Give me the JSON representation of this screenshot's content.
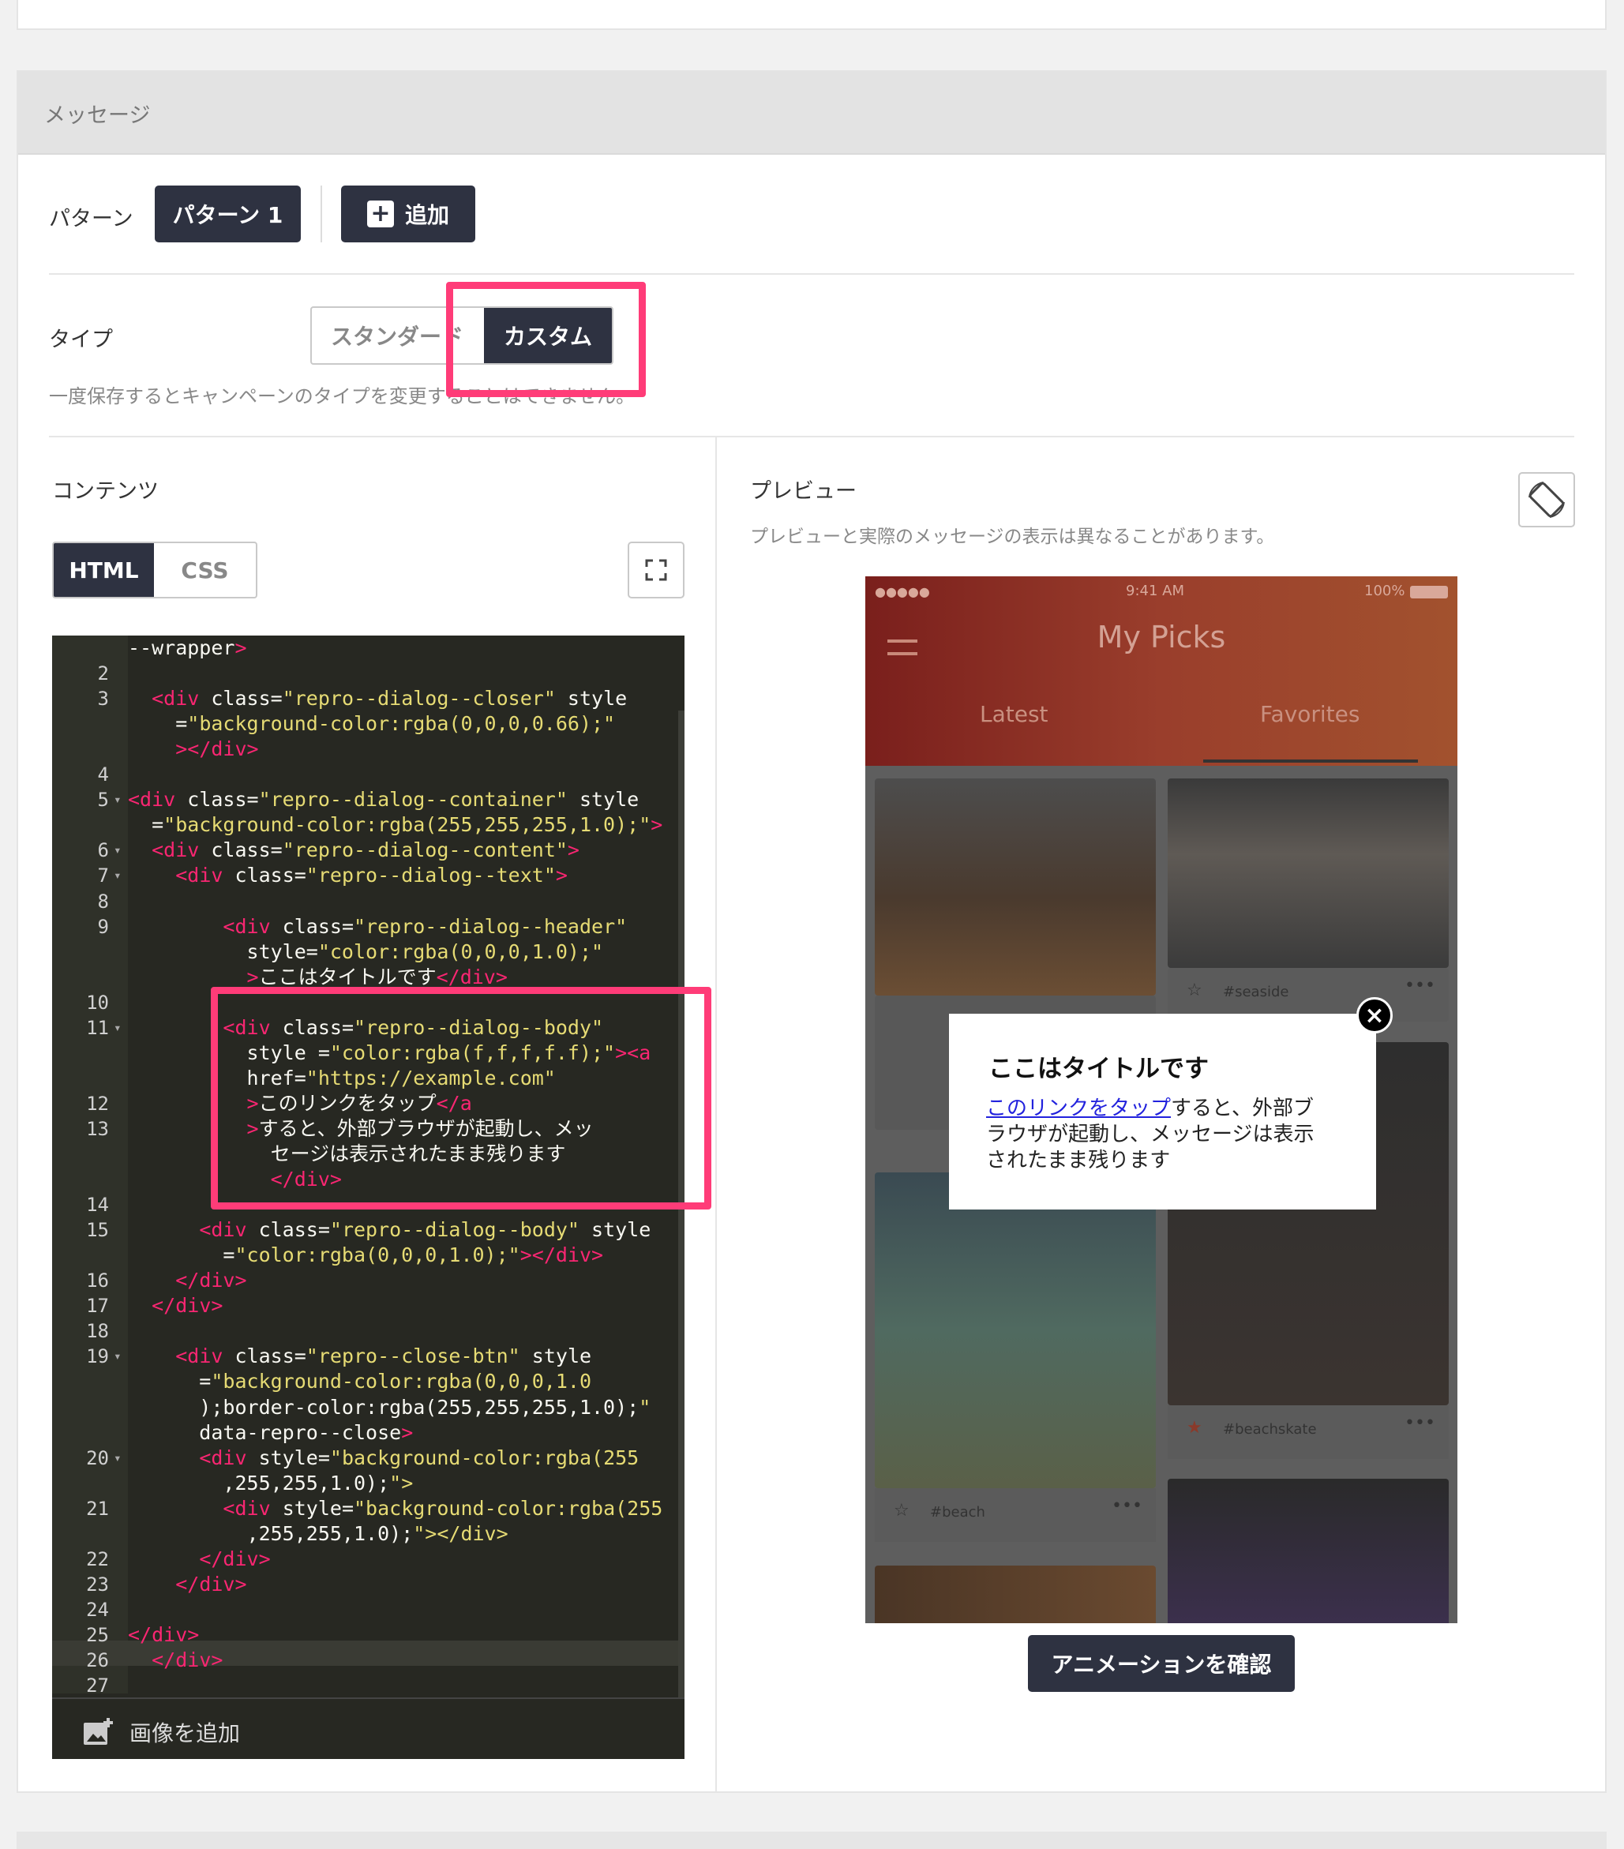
{
  "section": {
    "title": "メッセージ"
  },
  "pattern": {
    "label": "パターン",
    "active": "パターン 1",
    "add_label": "追加"
  },
  "type": {
    "label": "タイプ",
    "options": [
      "スタンダード",
      "カスタム"
    ],
    "selected": "カスタム",
    "note": "一度保存するとキャンペーンのタイプを変更することはできません。"
  },
  "content": {
    "label": "コンテンツ",
    "tabs": [
      "HTML",
      "CSS"
    ],
    "active_tab": "HTML",
    "add_image_label": "画像を追加"
  },
  "code_lines": [
    {
      "ln": "",
      "fold": false,
      "text": "    --wrapper>"
    },
    {
      "ln": "2",
      "fold": false,
      "text": ""
    },
    {
      "ln": "3",
      "fold": false,
      "text": "      <div class=\"repro--dialog--closer\" style"
    },
    {
      "ln": "",
      "fold": false,
      "text": "        =\"background-color:rgba(0,0,0,0.66);\""
    },
    {
      "ln": "",
      "fold": false,
      "text": "        ></div>"
    },
    {
      "ln": "4",
      "fold": false,
      "text": ""
    },
    {
      "ln": "5",
      "fold": true,
      "text": "    <div class=\"repro--dialog--container\" style"
    },
    {
      "ln": "",
      "fold": false,
      "text": "      =\"background-color:rgba(255,255,255,1.0);\">"
    },
    {
      "ln": "6",
      "fold": true,
      "text": "      <div class=\"repro--dialog--content\">"
    },
    {
      "ln": "7",
      "fold": true,
      "text": "        <div class=\"repro--dialog--text\">"
    },
    {
      "ln": "8",
      "fold": false,
      "text": ""
    },
    {
      "ln": "9",
      "fold": false,
      "text": "            <div class=\"repro--dialog--header\""
    },
    {
      "ln": "",
      "fold": false,
      "text": "              style=\"color:rgba(0,0,0,1.0);\""
    },
    {
      "ln": "",
      "fold": false,
      "text": "              >ここはタイトルです</div>"
    },
    {
      "ln": "10",
      "fold": false,
      "text": ""
    },
    {
      "ln": "11",
      "fold": true,
      "text": "            <div class=\"repro--dialog--body\""
    },
    {
      "ln": "",
      "fold": false,
      "text": "              style =\"color:rgba(f,f,f,f.f);\"><a"
    },
    {
      "ln": "",
      "fold": false,
      "text": "              href=\"https://example.com\""
    },
    {
      "ln": "12",
      "fold": false,
      "text": "              >このリンクをタップ</a"
    },
    {
      "ln": "13",
      "fold": false,
      "text": "              >すると、外部ブラウザが起動し、メッ"
    },
    {
      "ln": "",
      "fold": false,
      "text": "                セージは表示されたまま残ります"
    },
    {
      "ln": "",
      "fold": false,
      "text": "                </div>"
    },
    {
      "ln": "14",
      "fold": false,
      "text": ""
    },
    {
      "ln": "15",
      "fold": false,
      "text": "          <div class=\"repro--dialog--body\" style"
    },
    {
      "ln": "",
      "fold": false,
      "text": "            =\"color:rgba(0,0,0,1.0);\"></div>"
    },
    {
      "ln": "16",
      "fold": false,
      "text": "        </div>"
    },
    {
      "ln": "17",
      "fold": false,
      "text": "      </div>"
    },
    {
      "ln": "18",
      "fold": false,
      "text": ""
    },
    {
      "ln": "19",
      "fold": true,
      "text": "        <div class=\"repro--close-btn\" style"
    },
    {
      "ln": "",
      "fold": false,
      "text": "          =\"background-color:rgba(0,0,0,1.0"
    },
    {
      "ln": "",
      "fold": false,
      "text": "          );border-color:rgba(255,255,255,1.0);\""
    },
    {
      "ln": "",
      "fold": false,
      "text": "          data-repro--close>"
    },
    {
      "ln": "20",
      "fold": true,
      "text": "          <div style=\"background-color:rgba(255"
    },
    {
      "ln": "",
      "fold": false,
      "text": "            ,255,255,1.0);\">"
    },
    {
      "ln": "21",
      "fold": false,
      "text": "            <div style=\"background-color:rgba(255"
    },
    {
      "ln": "",
      "fold": false,
      "text": "              ,255,255,1.0);\"></div>"
    },
    {
      "ln": "22",
      "fold": false,
      "text": "          </div>"
    },
    {
      "ln": "23",
      "fold": false,
      "text": "        </div>"
    },
    {
      "ln": "24",
      "fold": false,
      "text": ""
    },
    {
      "ln": "25",
      "fold": false,
      "text": "    </div>"
    },
    {
      "ln": "26",
      "fold": false,
      "text": "  </div>"
    },
    {
      "ln": "27",
      "fold": false,
      "text": ""
    }
  ],
  "preview": {
    "label": "プレビュー",
    "note": "プレビューと実際のメッセージの表示は異なることがあります。",
    "phone": {
      "time": "9:41 AM",
      "battery": "100%",
      "app_title": "My Picks",
      "tabs": [
        "Latest",
        "Favorites"
      ],
      "tags": [
        "#seaside",
        "#beachskate",
        "#beach"
      ]
    },
    "dialog": {
      "title": "ここはタイトルです",
      "link_text": "このリンクをタップ",
      "body_text": "すると、外部ブラウザが起動し、メッセージは表示されたまま残ります"
    },
    "animation_button": "アニメーションを確認"
  },
  "colors": {
    "dark_button": "#2e3241",
    "highlight": "#ff3c78",
    "editor_bg": "#272822"
  }
}
